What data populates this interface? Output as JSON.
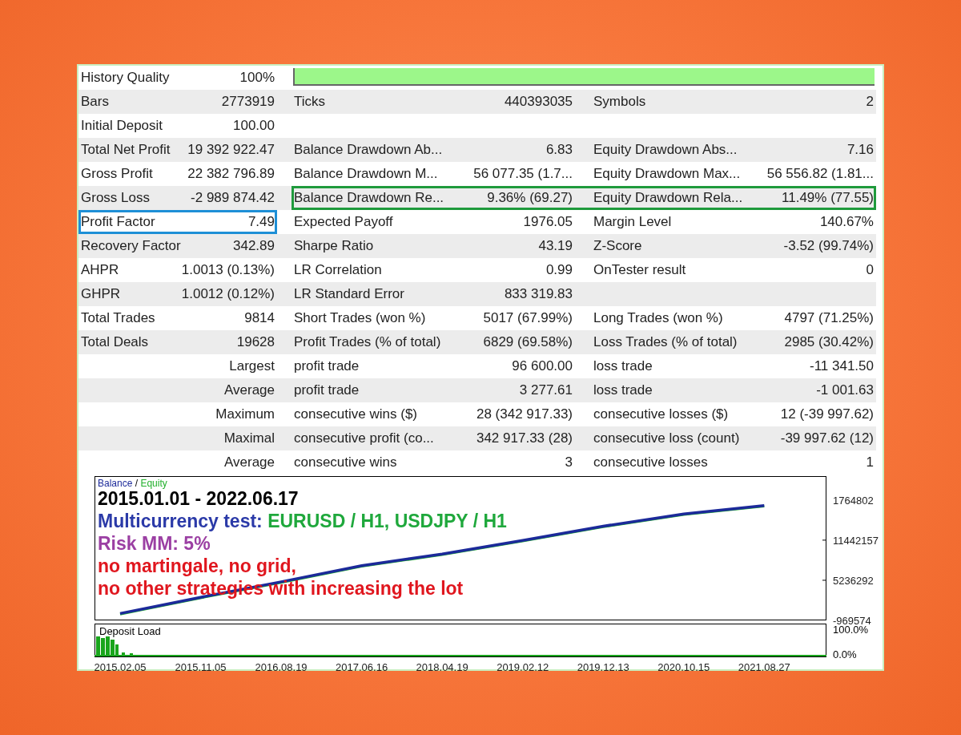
{
  "report": {
    "rows": [
      {
        "kind": "quality",
        "level": 1,
        "groups": [
          {
            "label": "History Quality",
            "value": "100%"
          }
        ]
      },
      {
        "groups": [
          {
            "label": "Bars",
            "value": "2773919"
          },
          {
            "label": "Ticks",
            "value": "440393035"
          },
          {
            "label": "Symbols",
            "value": "2"
          }
        ]
      },
      {
        "groups": [
          {
            "label": "Initial Deposit",
            "value": "100.00"
          }
        ]
      },
      {
        "groups": [
          {
            "label": "Total Net Profit",
            "value": "19 392 922.47"
          },
          {
            "label": "Balance Drawdown Ab...",
            "value": "6.83"
          },
          {
            "label": "Equity Drawdown Abs...",
            "value": "7.16"
          }
        ]
      },
      {
        "groups": [
          {
            "label": "Gross Profit",
            "value": "22 382 796.89"
          },
          {
            "label": "Balance Drawdown M...",
            "value": "56 077.35 (1.7..."
          },
          {
            "label": "Equity Drawdown Max...",
            "value": "56 556.82 (1.81..."
          }
        ]
      },
      {
        "groups": [
          {
            "label": "Gross Loss",
            "value": "-2 989 874.42"
          },
          {
            "label": "Balance Drawdown Re...",
            "value": "9.36% (69.27)",
            "frame": {
              "color": "#1f9a3c"
            }
          },
          {
            "label": "Equity Drawdown Rela...",
            "value": "11.49% (77.55)",
            "frame": {
              "color": "#1f9a3c"
            }
          }
        ]
      },
      {
        "groups": [
          {
            "label": "Profit Factor",
            "value": "7.49",
            "frame": {
              "color": "#1e8fd6"
            }
          },
          {
            "label": "Expected Payoff",
            "value": "1976.05"
          },
          {
            "label": "Margin Level",
            "value": "140.67%"
          }
        ]
      },
      {
        "groups": [
          {
            "label": "Recovery Factor",
            "value": "342.89"
          },
          {
            "label": "Sharpe Ratio",
            "value": "43.19"
          },
          {
            "label": "Z-Score",
            "value": "-3.52 (99.74%)"
          }
        ]
      },
      {
        "groups": [
          {
            "label": "AHPR",
            "value": "1.0013 (0.13%)"
          },
          {
            "label": "LR Correlation",
            "value": "0.99"
          },
          {
            "label": "OnTester result",
            "value": "0"
          }
        ]
      },
      {
        "groups": [
          {
            "label": "GHPR",
            "value": "1.0012 (0.12%)"
          },
          {
            "label": "LR Standard Error",
            "value": "833 319.83"
          }
        ]
      },
      {
        "groups": [
          {
            "label": "Total Trades",
            "value": "9814"
          },
          {
            "label": "Short Trades (won %)",
            "value": "5017 (67.99%)"
          },
          {
            "label": "Long Trades (won %)",
            "value": "4797 (71.25%)"
          }
        ]
      },
      {
        "groups": [
          {
            "label": "Total Deals",
            "value": "19628"
          },
          {
            "label": "Profit Trades (% of total)",
            "value": "6829 (69.58%)"
          },
          {
            "label": "Loss Trades (% of total)",
            "value": "2985 (30.42%)"
          }
        ]
      },
      {
        "groups": [
          {
            "value": "Largest"
          },
          {
            "label": "profit trade",
            "value": "96 600.00"
          },
          {
            "label": "loss trade",
            "value": "-11 341.50"
          }
        ]
      },
      {
        "groups": [
          {
            "value": "Average"
          },
          {
            "label": "profit trade",
            "value": "3 277.61"
          },
          {
            "label": "loss trade",
            "value": "-1 001.63"
          }
        ]
      },
      {
        "groups": [
          {
            "value": "Maximum"
          },
          {
            "label": "consecutive wins ($)",
            "value": "28 (342 917.33)"
          },
          {
            "label": "consecutive losses ($)",
            "value": "12 (-39 997.62)"
          }
        ]
      },
      {
        "groups": [
          {
            "value": "Maximal"
          },
          {
            "label": "consecutive profit (co...",
            "value": "342 917.33 (28)"
          },
          {
            "label": "consecutive loss (count)",
            "value": "-39 997.62 (12)"
          }
        ]
      },
      {
        "groups": [
          {
            "value": "Average"
          },
          {
            "label": "consecutive wins",
            "value": "3"
          },
          {
            "label": "consecutive losses",
            "value": "1"
          }
        ]
      }
    ]
  },
  "balance_chart": {
    "legend_separator": "/",
    "top_axis_label": "1764802",
    "annotations": [
      {
        "parts": [
          {
            "text": "2015.01.01 - 2022.06.17",
            "color": "#000000"
          }
        ]
      },
      {
        "parts": [
          {
            "text": "Multicurrency test: ",
            "color": "#2b3aa8"
          },
          {
            "text": "EURUSD / H1, USDJPY / H1",
            "color": "#1fa83c"
          }
        ]
      },
      {
        "parts": [
          {
            "text": "Risk MM: 5%",
            "color": "#9b3fa3"
          }
        ]
      },
      {
        "parts": [
          {
            "text": "no martingale, no grid,",
            "color": "#e0161e"
          }
        ]
      },
      {
        "parts": [
          {
            "text": "no other strategies with increasing the lot",
            "color": "#e0161e"
          }
        ]
      }
    ],
    "chart_data": {
      "type": "line",
      "categories": [
        "2015.02.05",
        "2015.11.05",
        "2016.08.19",
        "2017.06.16",
        "2018.04.19",
        "2019.02.12",
        "2019.12.13",
        "2020.10.15",
        "2021.08.27"
      ],
      "series": [
        {
          "name": "Balance",
          "color": "#1c2a9a",
          "values": [
            100000,
            2600000,
            5000000,
            7500000,
            9300000,
            11400000,
            13600000,
            15500000,
            16800000
          ]
        },
        {
          "name": "Equity",
          "color": "#22b02c",
          "values": [
            0,
            2500000,
            4900000,
            7400000,
            9200000,
            11300000,
            13500000,
            15400000,
            16700000
          ]
        }
      ],
      "ylim": [
        -969574,
        21350000
      ],
      "yticks": [
        11442157,
        5236292,
        -969574
      ]
    }
  },
  "deposit_load": {
    "title": "Deposit Load",
    "ticks": [
      "100.0%",
      "0.0%"
    ]
  }
}
